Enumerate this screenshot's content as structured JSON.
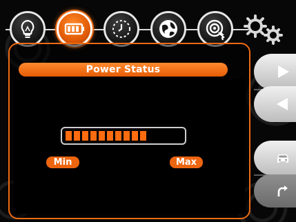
{
  "nav": {
    "items": [
      {
        "icon": "lightbulb-icon",
        "active": false
      },
      {
        "icon": "battery-icon",
        "active": true
      },
      {
        "icon": "clock-icon",
        "active": false
      },
      {
        "icon": "globe-icon",
        "active": false
      },
      {
        "icon": "target-icon",
        "active": false
      }
    ]
  },
  "settings_icon": "gears-icon",
  "panel": {
    "title": "Power Status",
    "meter": {
      "segments_filled": 10,
      "segments_total": 16,
      "level_fraction": 0.62
    },
    "min_label": "Min",
    "max_label": "Max"
  },
  "side_controls": [
    {
      "icon": "play-right-icon"
    },
    {
      "icon": "play-left-icon"
    },
    {
      "icon": "car-icon"
    },
    {
      "icon": "return-arrow-icon"
    }
  ],
  "colors": {
    "accent": "#EE6510",
    "panel_bg": "#000000",
    "text": "#FFFFFF"
  }
}
